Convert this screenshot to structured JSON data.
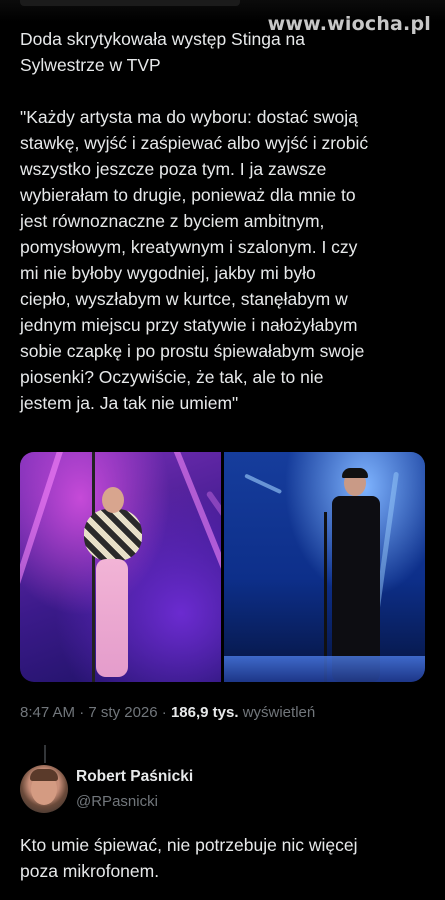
{
  "watermark": "www.wiocha.pl",
  "tweet": {
    "text": "Doda skrytykowała występ Stinga na\nSylwestrze w TVP\n\n\"Każdy artysta ma do wyboru: dostać swoją\nstawkę, wyjść i zaśpiewać albo wyjść i zrobić\nwszystko jeszcze poza tym. I ja zawsze\nwybierałam to drugie, ponieważ dla mnie to\njest równoznaczne z byciem ambitnym,\npomysłowym, kreatywnym i szalonym. I czy\nmi nie byłoby wygodniej, jakby mi było\nciepło, wyszłabym w kurtce, stanęłabym w\njednym miejscu przy statywie i nałożyłabym\nsobie czapkę i po prostu śpiewałabym swoje\npiosenki? Oczywiście, że tak, ale to nie\njestem ja. Ja tak nie umiem\"",
    "time": "8:47 AM",
    "separator": "·",
    "date": "7 sty 2026",
    "views_count": "186,9 tys.",
    "views_label": "wyświetleń"
  },
  "reply": {
    "name": "Robert Paśnicki",
    "handle": "@RPasnicki",
    "text": "Kto umie śpiewać, nie potrzebuje nic więcej\npoza mikrofonem."
  }
}
